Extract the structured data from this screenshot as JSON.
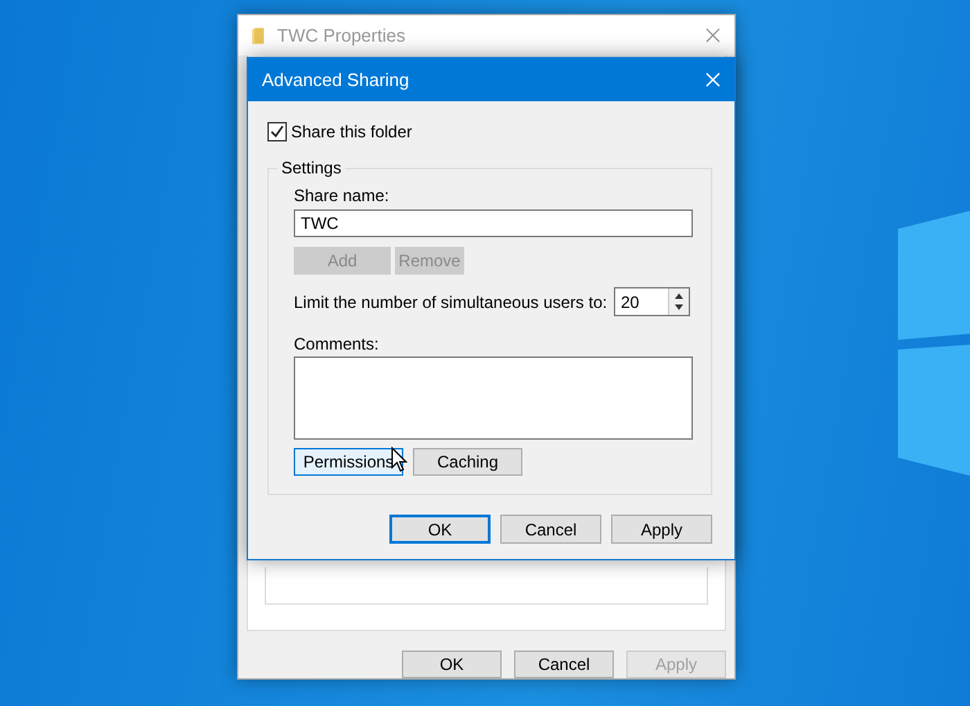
{
  "back_window": {
    "title": "TWC Properties",
    "buttons": [
      {
        "label": "OK",
        "disabled": false
      },
      {
        "label": "Cancel",
        "disabled": false
      },
      {
        "label": "Apply",
        "disabled": true
      }
    ]
  },
  "dialog": {
    "title": "Advanced Sharing",
    "share_checkbox": {
      "label": "Share this folder",
      "checked": true
    },
    "settings": {
      "title": "Settings",
      "share_name": {
        "label": "Share name:",
        "value": "TWC"
      },
      "name_buttons": [
        {
          "label": "Add",
          "disabled": true
        },
        {
          "label": "Remove",
          "disabled": true
        }
      ],
      "limit": {
        "label": "Limit the number of simultaneous users to:",
        "value": "20"
      },
      "comments": {
        "label": "Comments:"
      },
      "buttons": [
        {
          "label": "Permissions",
          "hovered": true
        },
        {
          "label": "Caching",
          "hovered": false
        }
      ]
    },
    "buttons": [
      {
        "label": "OK",
        "default": true
      },
      {
        "label": "Cancel",
        "default": false
      },
      {
        "label": "Apply",
        "default": false
      }
    ]
  }
}
